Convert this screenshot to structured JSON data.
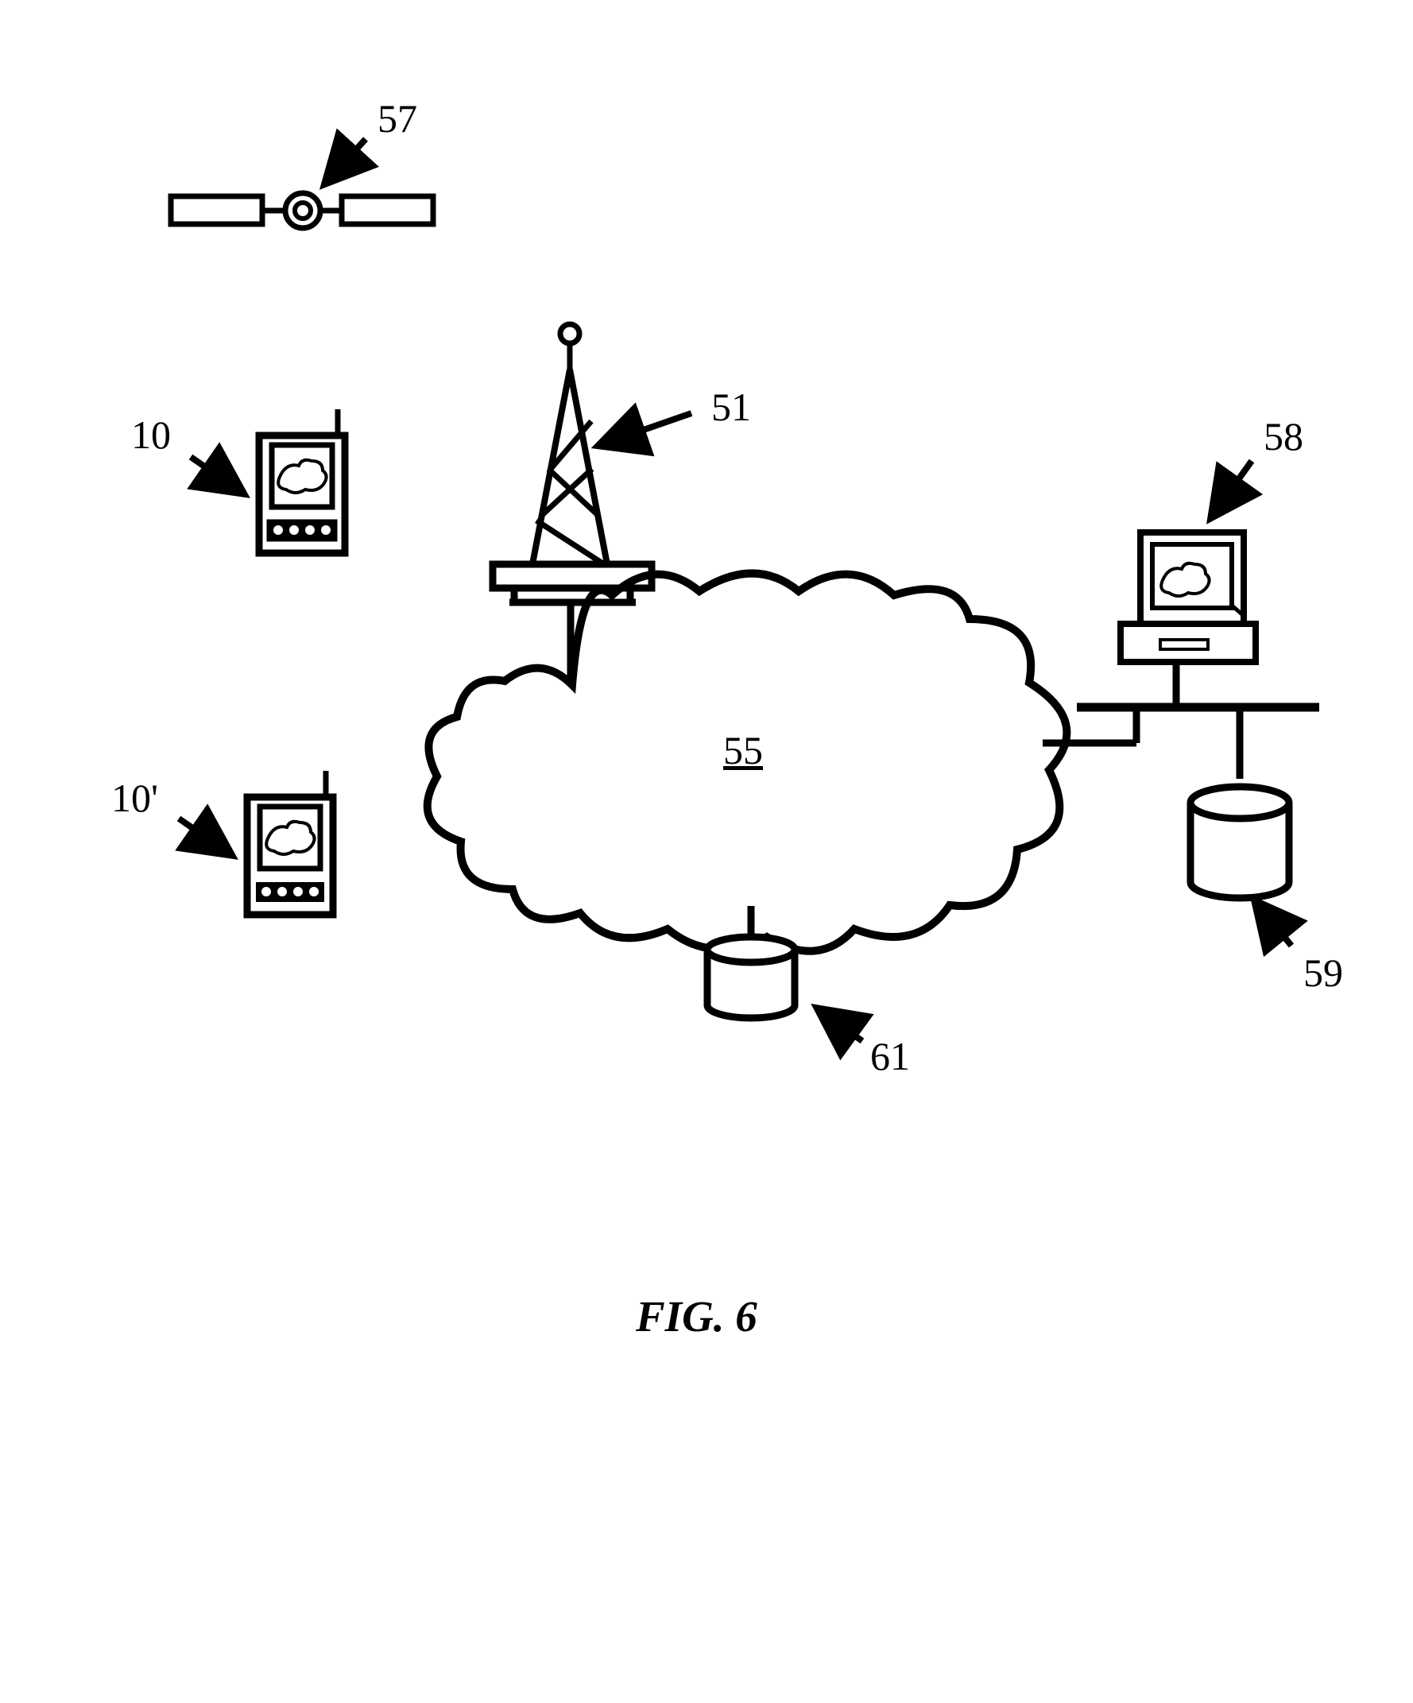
{
  "labels": {
    "satellite": "57",
    "device1": "10",
    "device2": "10'",
    "tower": "51",
    "cloud": "55",
    "computer": "58",
    "db_right": "59",
    "db_center": "61"
  },
  "figure_caption": "FIG. 6",
  "chart_data": {
    "type": "diagram",
    "title": "FIG. 6",
    "nodes": [
      {
        "id": "57",
        "kind": "satellite"
      },
      {
        "id": "10",
        "kind": "mobile-device"
      },
      {
        "id": "10'",
        "kind": "mobile-device"
      },
      {
        "id": "51",
        "kind": "cell-tower"
      },
      {
        "id": "55",
        "kind": "network-cloud"
      },
      {
        "id": "58",
        "kind": "computer"
      },
      {
        "id": "59",
        "kind": "database"
      },
      {
        "id": "61",
        "kind": "database"
      }
    ],
    "edges": [
      {
        "from": "51",
        "to": "55",
        "kind": "wired"
      },
      {
        "from": "55",
        "to": "61",
        "kind": "wired"
      },
      {
        "from": "55",
        "to": "58",
        "kind": "wired"
      },
      {
        "from": "58",
        "to": "59",
        "kind": "wired"
      }
    ]
  }
}
